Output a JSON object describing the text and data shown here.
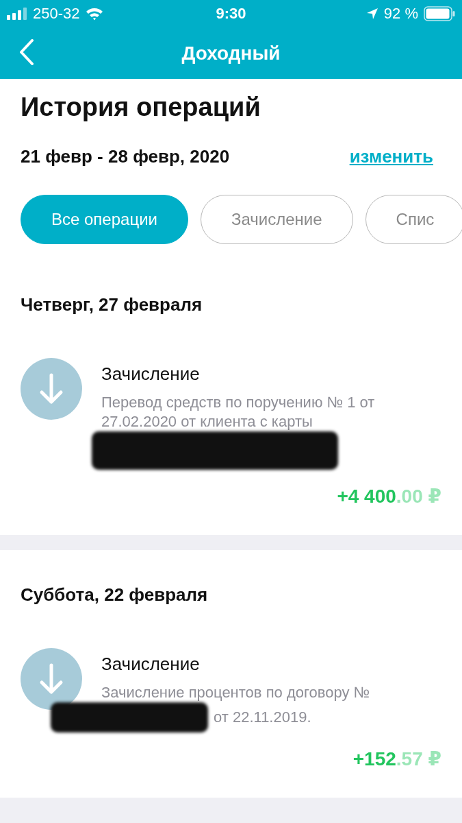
{
  "status_bar": {
    "carrier": "250-32",
    "time": "9:30",
    "battery": "92 %"
  },
  "nav": {
    "title": "Доходный"
  },
  "page_title": "История операций",
  "period": {
    "range": "21 февр - 28 февр, 2020",
    "change_link": "изменить"
  },
  "filters": [
    {
      "label": "Все операции",
      "selected": true
    },
    {
      "label": "Зачисление",
      "selected": false
    },
    {
      "label": "Спис",
      "selected": false
    }
  ],
  "days": [
    {
      "date": "Четверг, 27 февраля",
      "operations": [
        {
          "title": "Зачисление",
          "description": "Перевод средств по поручению № 1 от 27.02.2020 от клиента с карты",
          "redacted": true,
          "amount_main": "+4 400",
          "amount_fraction": ".00 ₽"
        }
      ]
    },
    {
      "date": "Суббота, 22 февраля",
      "operations": [
        {
          "title": "Зачисление",
          "description": "Зачисление процентов по договору №",
          "redacted": true,
          "description_tail": "от 22.11.2019.",
          "amount_main": "+152",
          "amount_fraction": ".57 ₽"
        }
      ]
    }
  ]
}
